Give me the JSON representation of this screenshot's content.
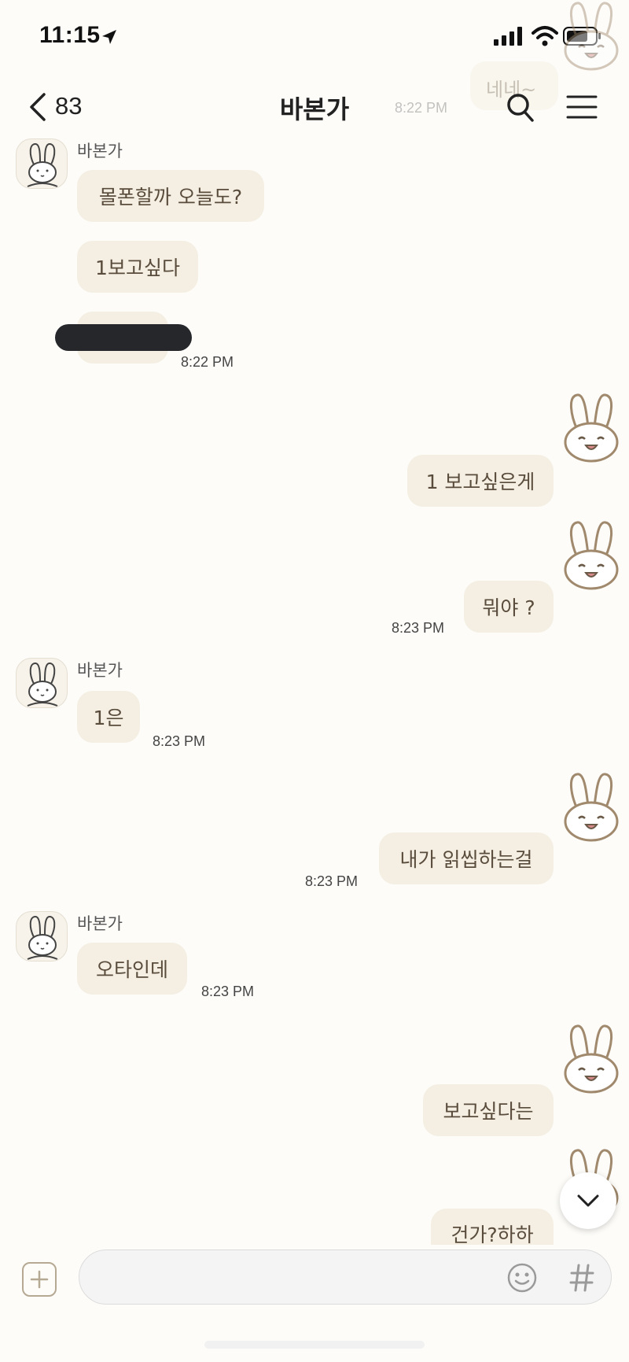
{
  "status_bar": {
    "time": "11:15"
  },
  "header": {
    "back_count": "83",
    "title": "바본가"
  },
  "ghost": {
    "bubble_text": "네네~",
    "time": "8:22 PM"
  },
  "messages": [
    {
      "side": "left",
      "sender": "바본가",
      "text": "몰폰할까 오늘도?"
    },
    {
      "side": "left",
      "text": "1보고싶다"
    },
    {
      "side": "left",
      "text": "",
      "redacted": true,
      "time": "8:22 PM"
    },
    {
      "side": "right",
      "text": "1 보고싶은게"
    },
    {
      "side": "right",
      "text": "뭐야 ?",
      "time": "8:23 PM"
    },
    {
      "side": "left",
      "sender": "바본가",
      "text": "1은",
      "time": "8:23 PM"
    },
    {
      "side": "right",
      "text": "내가 읽씹하는걸",
      "time": "8:23 PM"
    },
    {
      "side": "left",
      "sender": "바본가",
      "text": "오타인데",
      "time": "8:23 PM"
    },
    {
      "side": "right",
      "text": "보고싶다는"
    },
    {
      "side": "right",
      "text": "건가?하하"
    }
  ],
  "input": {
    "placeholder": ""
  },
  "icons": [
    "location-arrow-icon",
    "signal-icon",
    "wifi-icon",
    "battery-icon",
    "back-chevron-icon",
    "search-icon",
    "menu-icon",
    "rabbit-avatar-icon",
    "rabbit-sticker-icon",
    "chevron-down-icon",
    "plus-icon",
    "emoji-icon",
    "hashtag-icon"
  ],
  "colors": {
    "bubble": "#f4efe2",
    "background": "#fdfcf9",
    "text": "#5a4c3c"
  }
}
